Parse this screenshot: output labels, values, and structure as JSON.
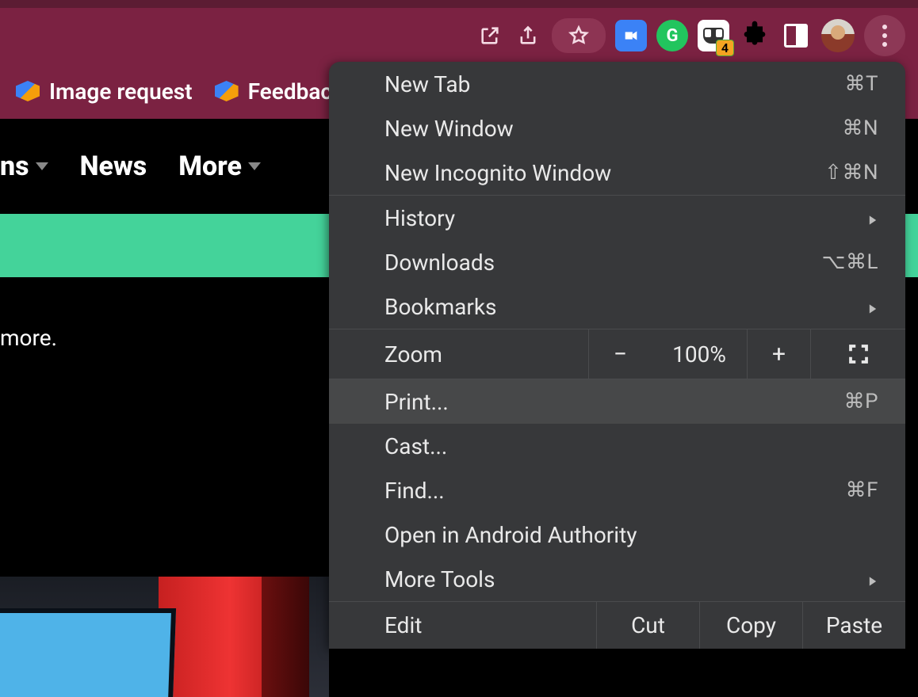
{
  "toolbar": {
    "extension_badge": "4"
  },
  "bookmarks": {
    "items": [
      {
        "label": "Image request"
      },
      {
        "label": "Feedback"
      }
    ]
  },
  "nav": {
    "item0_suffix": "ns",
    "item1": "News",
    "item2": "More"
  },
  "page": {
    "snippet": "more."
  },
  "menu": {
    "new_tab": {
      "label": "New Tab",
      "shortcut": "⌘T"
    },
    "new_window": {
      "label": "New Window",
      "shortcut": "⌘N"
    },
    "new_incognito": {
      "label": "New Incognito Window",
      "shortcut": "⇧⌘N"
    },
    "history": {
      "label": "History"
    },
    "downloads": {
      "label": "Downloads",
      "shortcut": "⌥⌘L"
    },
    "bookmarks": {
      "label": "Bookmarks"
    },
    "zoom": {
      "label": "Zoom",
      "value": "100%"
    },
    "print": {
      "label": "Print...",
      "shortcut": "⌘P"
    },
    "cast": {
      "label": "Cast..."
    },
    "find": {
      "label": "Find...",
      "shortcut": "⌘F"
    },
    "open_in_app": {
      "label": "Open in Android Authority"
    },
    "more_tools": {
      "label": "More Tools"
    },
    "edit": {
      "label": "Edit",
      "cut": "Cut",
      "copy": "Copy",
      "paste": "Paste"
    }
  }
}
